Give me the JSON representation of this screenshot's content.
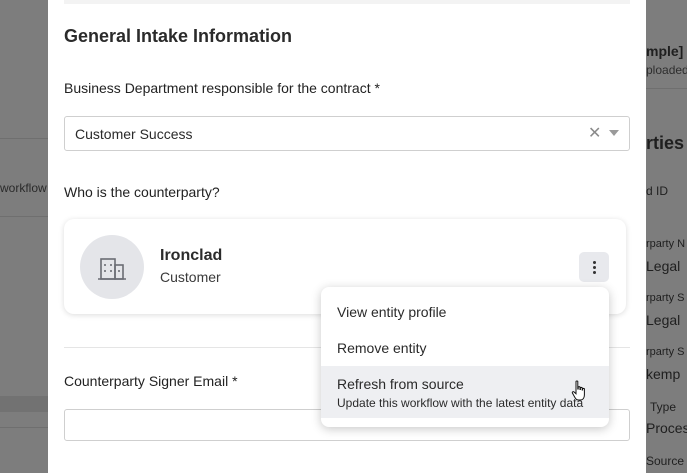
{
  "form": {
    "title": "General Intake Information",
    "department_label": "Business Department responsible for the contract *",
    "department_value": "Customer Success",
    "counterparty_label": "Who is the counterparty?",
    "signer_email_label": "Counterparty Signer Email *",
    "signer_email_value": ""
  },
  "entity": {
    "name": "Ironclad",
    "type": "Customer",
    "icon": "building-icon"
  },
  "menu": {
    "items": [
      {
        "label": "View entity profile"
      },
      {
        "label": "Remove entity"
      },
      {
        "label": "Refresh from source",
        "description": "Update this workflow with the latest entity data"
      }
    ]
  },
  "background": {
    "left_fragment": "workflow",
    "right_fragments": [
      "mple] A",
      "ploaded",
      "rties",
      "d ID",
      "rparty N",
      "Legal",
      "rparty S",
      "Legal",
      "rparty S",
      "kemp",
      "Type",
      "Process",
      "Source"
    ]
  }
}
